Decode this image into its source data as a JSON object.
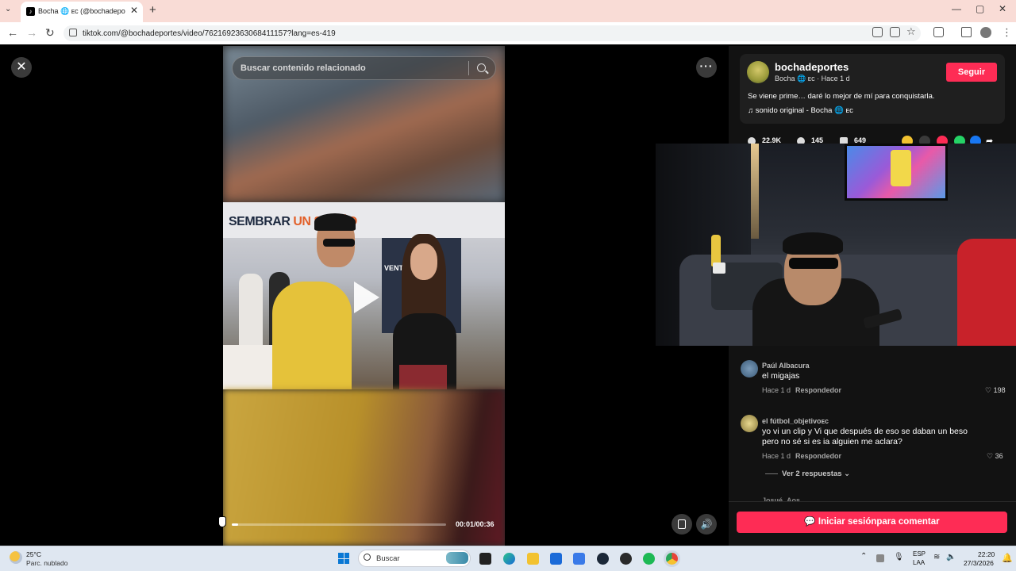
{
  "browser": {
    "tab_title": "Bocha 🌐 ᴇᴄ (@bochadeportes) |",
    "tab_favicon": "♪",
    "tab_close": "✕",
    "new_tab": "+",
    "url": "tiktok.com/@bochadeportes/video/7621692363068411157?lang=es-419",
    "window_controls": [
      "—",
      "▢",
      "✕"
    ]
  },
  "video": {
    "search_placeholder": "Buscar contenido relacionado",
    "banner_text_1": "SEMBRAR",
    "banner_text_2": "UN SUEÑO",
    "store_sign": "VENTAS",
    "time": "00:01/00:36",
    "progress": 0.028
  },
  "author": {
    "username": "bochadeportes",
    "display": "Bocha 🌐 ᴇᴄ · Hace 1 d",
    "follow": "Seguir",
    "description": "Se viene prime… daré lo mejor de mí para conquistarla.",
    "sound": "♫  sonido original - Bocha 🌐 ᴇᴄ"
  },
  "stats": {
    "likes": "22.9K",
    "comments": "145",
    "saves": "649"
  },
  "comments": [
    {
      "name": "Paúl Albacura",
      "text": "el migajas",
      "time": "Hace 1 d",
      "reply": "Respondedor",
      "likes": "♡ 198"
    },
    {
      "name": "el fútbol_objetivoᴇᴄ",
      "text": "yo vi un clip y Vi que después de eso se daban un beso pero no sé si es ia alguien me aclara?",
      "time": "Hace 1 d",
      "reply": "Respondedor",
      "likes": "♡ 36"
    }
  ],
  "replies_link": "Ver 2 respuestas ⌄",
  "cut_name": "Josué_Aos",
  "login_button": "💬 Iniciar sesiónpara comentar",
  "taskbar": {
    "temp": "25°C",
    "condition": "Parc. nublado",
    "search_placeholder": "Buscar",
    "lang1": "ESP",
    "lang2": "LAA",
    "time": "22:20",
    "date": "27/3/2026"
  },
  "colors": {
    "accent": "#fe2c55",
    "tab_strip": "#f9dcd6"
  }
}
